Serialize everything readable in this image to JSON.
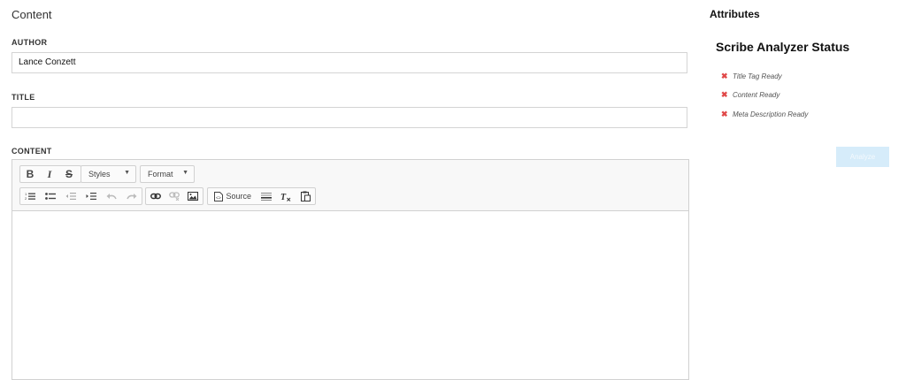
{
  "main": {
    "section_title": "Content",
    "author": {
      "label": "AUTHOR",
      "value": "Lance Conzett"
    },
    "title": {
      "label": "TITLE",
      "value": ""
    },
    "content": {
      "label": "CONTENT",
      "toolbar": {
        "bold": "B",
        "italic": "I",
        "strike": "S",
        "styles_label": "Styles",
        "format_label": "Format",
        "source_label": "Source"
      },
      "body": ""
    }
  },
  "sidebar": {
    "title": "Attributes",
    "analyzer_title": "Scribe Analyzer Status",
    "status_items": [
      {
        "icon": "x-icon",
        "label": "Title Tag Ready"
      },
      {
        "icon": "x-icon",
        "label": "Content Ready"
      },
      {
        "icon": "x-icon",
        "label": "Meta Description Ready"
      }
    ],
    "analyze_label": "Analyze"
  },
  "colors": {
    "status_fail": "#e04848",
    "analyze_button_bg": "#d6ecfa",
    "border": "#d4d4d4"
  }
}
